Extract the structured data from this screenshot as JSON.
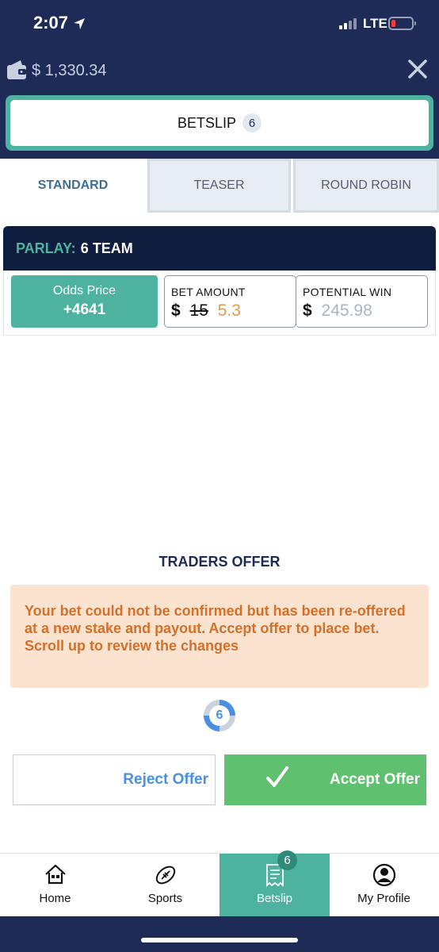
{
  "status_bar": {
    "time": "2:07",
    "network": "LTE"
  },
  "header": {
    "balance": "$ 1,330.34"
  },
  "betslip": {
    "title": "BETSLIP",
    "count": "6"
  },
  "tabs": [
    {
      "label": "STANDARD",
      "active": true
    },
    {
      "label": "TEASER",
      "active": false
    },
    {
      "label": "ROUND ROBIN",
      "active": false
    }
  ],
  "parlay": {
    "label": "PARLAY:",
    "value": "6 TEAM"
  },
  "bet": {
    "odds_label": "Odds Price",
    "odds_value": "+4641",
    "amount_label": "BET AMOUNT",
    "currency": "$",
    "old_amount": "15",
    "new_amount": "5.3",
    "win_label": "POTENTIAL WIN",
    "win_value": "245.98"
  },
  "offer": {
    "title": "TRADERS OFFER",
    "message": "Your bet could not be confirmed but has been re-offered at a new stake and payout. Accept offer to place bet.",
    "hint": "Scroll up to review the changes",
    "countdown": "6",
    "reject_label": "Reject Offer",
    "accept_label": "Accept Offer"
  },
  "nav": [
    {
      "label": "Home",
      "icon": "home-icon"
    },
    {
      "label": "Sports",
      "icon": "football-icon"
    },
    {
      "label": "Betslip",
      "icon": "receipt-icon",
      "badge": "6",
      "active": true
    },
    {
      "label": "My Profile",
      "icon": "profile-icon"
    }
  ],
  "colors": {
    "navy": "#1e2b57",
    "teal": "#4db3a0",
    "accept_green": "#5fc06f",
    "link_blue": "#4a90e2",
    "notice_bg": "#fbe3d0",
    "notice_text": "#d4702a"
  }
}
